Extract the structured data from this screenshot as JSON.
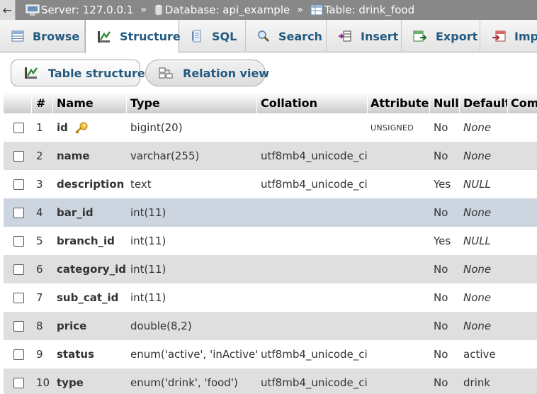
{
  "breadcrumb": {
    "back": "←",
    "server": "Server: 127.0.0.1",
    "database": "Database: api_example",
    "table": "Table: drink_food",
    "separator": "»"
  },
  "tabs": [
    {
      "label": "Browse",
      "icon": "browse-icon"
    },
    {
      "label": "Structure",
      "icon": "structure-icon",
      "active": true
    },
    {
      "label": "SQL",
      "icon": "sql-icon"
    },
    {
      "label": "Search",
      "icon": "search-icon"
    },
    {
      "label": "Insert",
      "icon": "insert-icon"
    },
    {
      "label": "Export",
      "icon": "export-icon"
    },
    {
      "label": "Impo",
      "icon": "import-icon"
    }
  ],
  "subnav": {
    "table_structure": "Table structure",
    "relation_view": "Relation view"
  },
  "columns": {
    "num": "#",
    "name": "Name",
    "type": "Type",
    "collation": "Collation",
    "attributes": "Attributes",
    "null": "Null",
    "default": "Default",
    "comments": "Com"
  },
  "rows": [
    {
      "num": "1",
      "name": "id",
      "type": "bigint(20)",
      "collation": "",
      "attributes": "UNSIGNED",
      "null": "No",
      "default": "None",
      "key": true
    },
    {
      "num": "2",
      "name": "name",
      "type": "varchar(255)",
      "collation": "utf8mb4_unicode_ci",
      "attributes": "",
      "null": "No",
      "default": "None"
    },
    {
      "num": "3",
      "name": "description",
      "type": "text",
      "collation": "utf8mb4_unicode_ci",
      "attributes": "",
      "null": "Yes",
      "default": "NULL"
    },
    {
      "num": "4",
      "name": "bar_id",
      "type": "int(11)",
      "collation": "",
      "attributes": "",
      "null": "No",
      "default": "None"
    },
    {
      "num": "5",
      "name": "branch_id",
      "type": "int(11)",
      "collation": "",
      "attributes": "",
      "null": "Yes",
      "default": "NULL"
    },
    {
      "num": "6",
      "name": "category_id",
      "type": "int(11)",
      "collation": "",
      "attributes": "",
      "null": "No",
      "default": "None"
    },
    {
      "num": "7",
      "name": "sub_cat_id",
      "type": "int(11)",
      "collation": "",
      "attributes": "",
      "null": "No",
      "default": "None"
    },
    {
      "num": "8",
      "name": "price",
      "type": "double(8,2)",
      "collation": "",
      "attributes": "",
      "null": "No",
      "default": "None"
    },
    {
      "num": "9",
      "name": "status",
      "type": "enum('active', 'inActive')",
      "collation": "utf8mb4_unicode_ci",
      "attributes": "",
      "null": "No",
      "default": "active"
    },
    {
      "num": "10",
      "name": "type",
      "type": "enum('drink', 'food')",
      "collation": "utf8mb4_unicode_ci",
      "attributes": "",
      "null": "No",
      "default": "drink"
    }
  ],
  "colors": {
    "link": "#235a81",
    "header_bar": "#888888",
    "row_even": "#dfdfdf",
    "row_highlight": "#ccd5e0"
  }
}
